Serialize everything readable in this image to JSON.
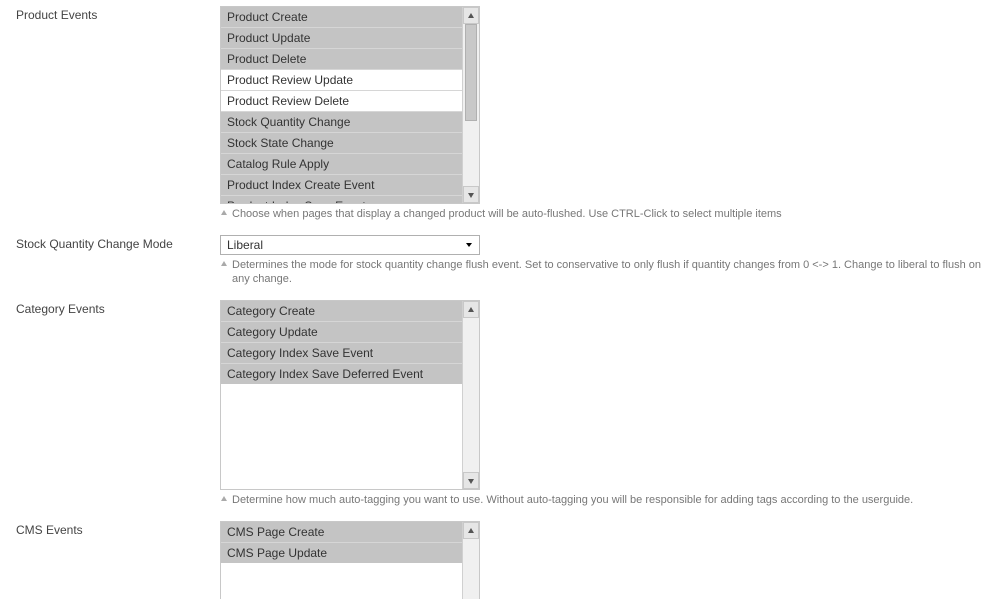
{
  "productEvents": {
    "label": "Product Events",
    "options": [
      {
        "label": "Product Create",
        "selected": true
      },
      {
        "label": "Product Update",
        "selected": true
      },
      {
        "label": "Product Delete",
        "selected": true
      },
      {
        "label": "Product Review Update",
        "selected": false
      },
      {
        "label": "Product Review Delete",
        "selected": false
      },
      {
        "label": "Stock Quantity Change",
        "selected": true
      },
      {
        "label": "Stock State Change",
        "selected": true
      },
      {
        "label": "Catalog Rule Apply",
        "selected": true
      },
      {
        "label": "Product Index Create Event",
        "selected": true
      },
      {
        "label": "Product Index Save Event",
        "selected": true
      }
    ],
    "hint": "Choose when pages that display a changed product will be auto-flushed. Use CTRL-Click to select multiple items"
  },
  "stockMode": {
    "label": "Stock Quantity Change Mode",
    "value": "Liberal",
    "hint": "Determines the mode for stock quantity change flush event. Set to conservative to only flush if quantity changes from 0 <-> 1. Change to liberal to flush on any change."
  },
  "categoryEvents": {
    "label": "Category Events",
    "options": [
      {
        "label": "Category Create",
        "selected": true
      },
      {
        "label": "Category Update",
        "selected": true
      },
      {
        "label": "Category Index Save Event",
        "selected": true
      },
      {
        "label": "Category Index Save Deferred Event",
        "selected": true
      }
    ],
    "hint": "Determine how much auto-tagging you want to use. Without auto-tagging you will be responsible for adding tags according to the userguide."
  },
  "cmsEvents": {
    "label": "CMS Events",
    "options": [
      {
        "label": "CMS Page Create",
        "selected": true
      },
      {
        "label": "CMS Page Update",
        "selected": true
      }
    ]
  }
}
